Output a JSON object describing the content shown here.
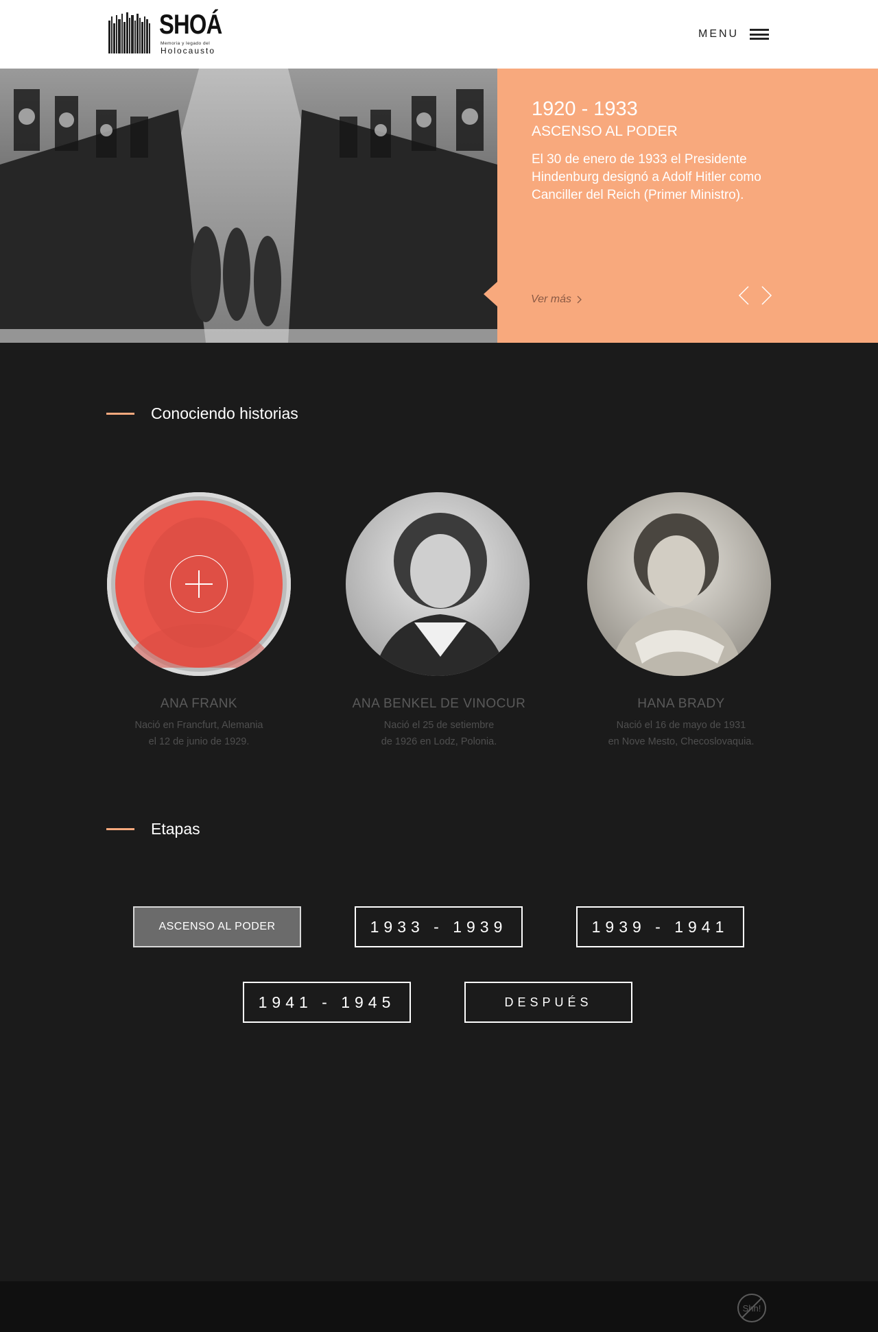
{
  "header": {
    "logo_word": "SHOÁ",
    "logo_tagline": "Memoria y legado del",
    "logo_subword": "Holocausto",
    "menu_label": "MENU"
  },
  "hero": {
    "years": "1920 - 1933",
    "title": "ASCENSO AL PODER",
    "text": "El 30 de enero de 1933 el Presidente Hindenburg designó a Adolf Hitler como Canciller del Reich (Primer Ministro).",
    "more_label": "Ver más",
    "accent_color": "#f8a97d"
  },
  "stories": {
    "heading": "Conociendo historias",
    "people": [
      {
        "name": "ANA FRANK",
        "desc_line1": "Nació en Francfurt, Alemania",
        "desc_line2": "el 12 de junio de 1929.",
        "highlighted": true
      },
      {
        "name": "ANA BENKEL DE VINOCUR",
        "desc_line1": "Nació el 25 de setiembre",
        "desc_line2": "de 1926 en Lodz, Polonia.",
        "highlighted": false
      },
      {
        "name": "HANA BRADY",
        "desc_line1": "Nació el 16 de mayo de 1931",
        "desc_line2": "en Nove Mesto, Checoslovaquia.",
        "highlighted": false
      }
    ]
  },
  "stages": {
    "heading": "Etapas",
    "buttons": [
      {
        "label": "ASCENSO AL PODER",
        "active": true
      },
      {
        "label": "1933 - 1939",
        "active": false
      },
      {
        "label": "1939 - 1941",
        "active": false
      },
      {
        "label": "1941 - 1945",
        "active": false
      },
      {
        "label": "DESPUÉS",
        "active": false
      }
    ]
  },
  "footer": {
    "badge_text": "Shh!"
  }
}
